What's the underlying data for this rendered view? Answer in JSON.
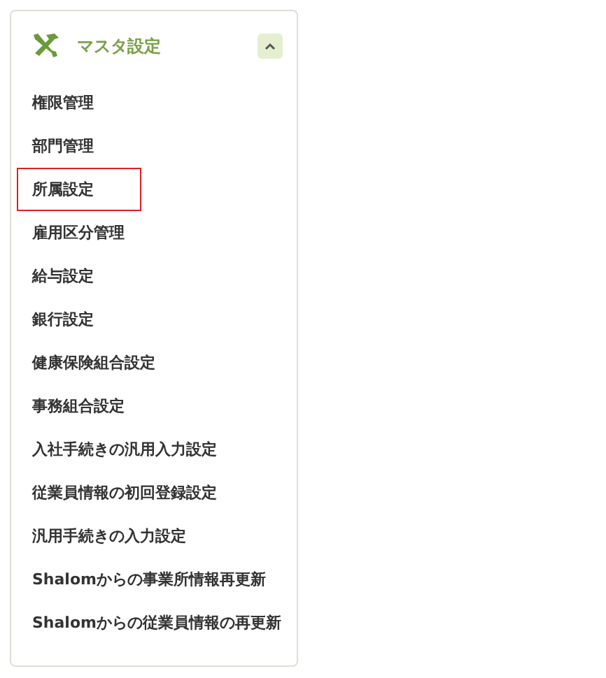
{
  "panel": {
    "title": "マスタ設定",
    "expanded": true,
    "items": [
      {
        "label": "権限管理",
        "selected": false
      },
      {
        "label": "部門管理",
        "selected": false
      },
      {
        "label": "所属設定",
        "selected": true
      },
      {
        "label": "雇用区分管理",
        "selected": false
      },
      {
        "label": "給与設定",
        "selected": false
      },
      {
        "label": "銀行設定",
        "selected": false
      },
      {
        "label": "健康保険組合設定",
        "selected": false
      },
      {
        "label": "事務組合設定",
        "selected": false
      },
      {
        "label": "入社手続きの汎用入力設定",
        "selected": false
      },
      {
        "label": "従業員情報の初回登録設定",
        "selected": false
      },
      {
        "label": "汎用手続きの入力設定",
        "selected": false
      },
      {
        "label": "Shalomからの事業所情報再更新",
        "selected": false
      },
      {
        "label": "Shalomからの従業員情報の再更新",
        "selected": false
      }
    ]
  }
}
